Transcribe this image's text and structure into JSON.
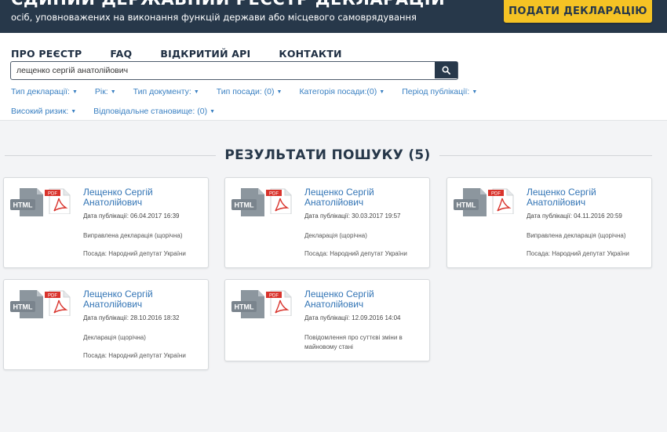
{
  "header": {
    "title": "ЄДИНИЙ ДЕРЖАВНИЙ РЕЄСТР ДЕКЛАРАЦІЙ",
    "subtitle": "осіб, уповноважених на виконання функцій держави або місцевого самоврядування",
    "submit_label": "ПОДАТИ ДЕКЛАРАЦІЮ"
  },
  "nav": {
    "items": [
      "ПРО РЕЄСТР",
      "FAQ",
      "ВІДКРИТИЙ API",
      "КОНТАКТИ"
    ]
  },
  "search": {
    "value": "лещенко сергій анатолійович",
    "button_icon": "search-icon"
  },
  "filters": {
    "row1": [
      "Тип декларації:",
      "Рік:",
      "Тип документу:",
      "Тип посади: (0)",
      "Категорія посади:(0)",
      "Період публікації:"
    ],
    "row2": [
      "Високий ризик:",
      "Відповідальне становище: (0)"
    ]
  },
  "results": {
    "title": "РЕЗУЛЬТАТИ ПОШУКУ (5)",
    "items": [
      {
        "name": "Лещенко Сергій Анатолійович",
        "date": "Дата публікації: 06.04.2017 16:39",
        "type": "Виправлена декларація (щорічна)",
        "position": "Посада: Народний депутат України"
      },
      {
        "name": "Лещенко Сергій Анатолійович",
        "date": "Дата публікації: 30.03.2017 19:57",
        "type": "Декларація (щорічна)",
        "position": "Посада: Народний депутат України"
      },
      {
        "name": "Лещенко Сергій Анатолійович",
        "date": "Дата публікації: 04.11.2016 20:59",
        "type": "Виправлена декларація (щорічна)",
        "position": "Посада: Народний депутат України"
      },
      {
        "name": "Лещенко Сергій Анатолійович",
        "date": "Дата публікації: 28.10.2016 18:32",
        "type": "Декларація (щорічна)",
        "position": "Посада: Народний депутат України"
      },
      {
        "name": "Лещенко Сергій Анатолійович",
        "date": "Дата публікації: 12.09.2016 14:04",
        "type": "Повідомлення про суттєві зміни в майновому стані",
        "position": ""
      }
    ]
  },
  "icons": {
    "html_label": "HTML",
    "pdf_label": "PDF"
  },
  "colors": {
    "header_bg": "#27384a",
    "accent_yellow": "#f5c324",
    "link_blue": "#3274b5",
    "filter_blue": "#3a80c2",
    "pdf_red": "#d9332c"
  }
}
